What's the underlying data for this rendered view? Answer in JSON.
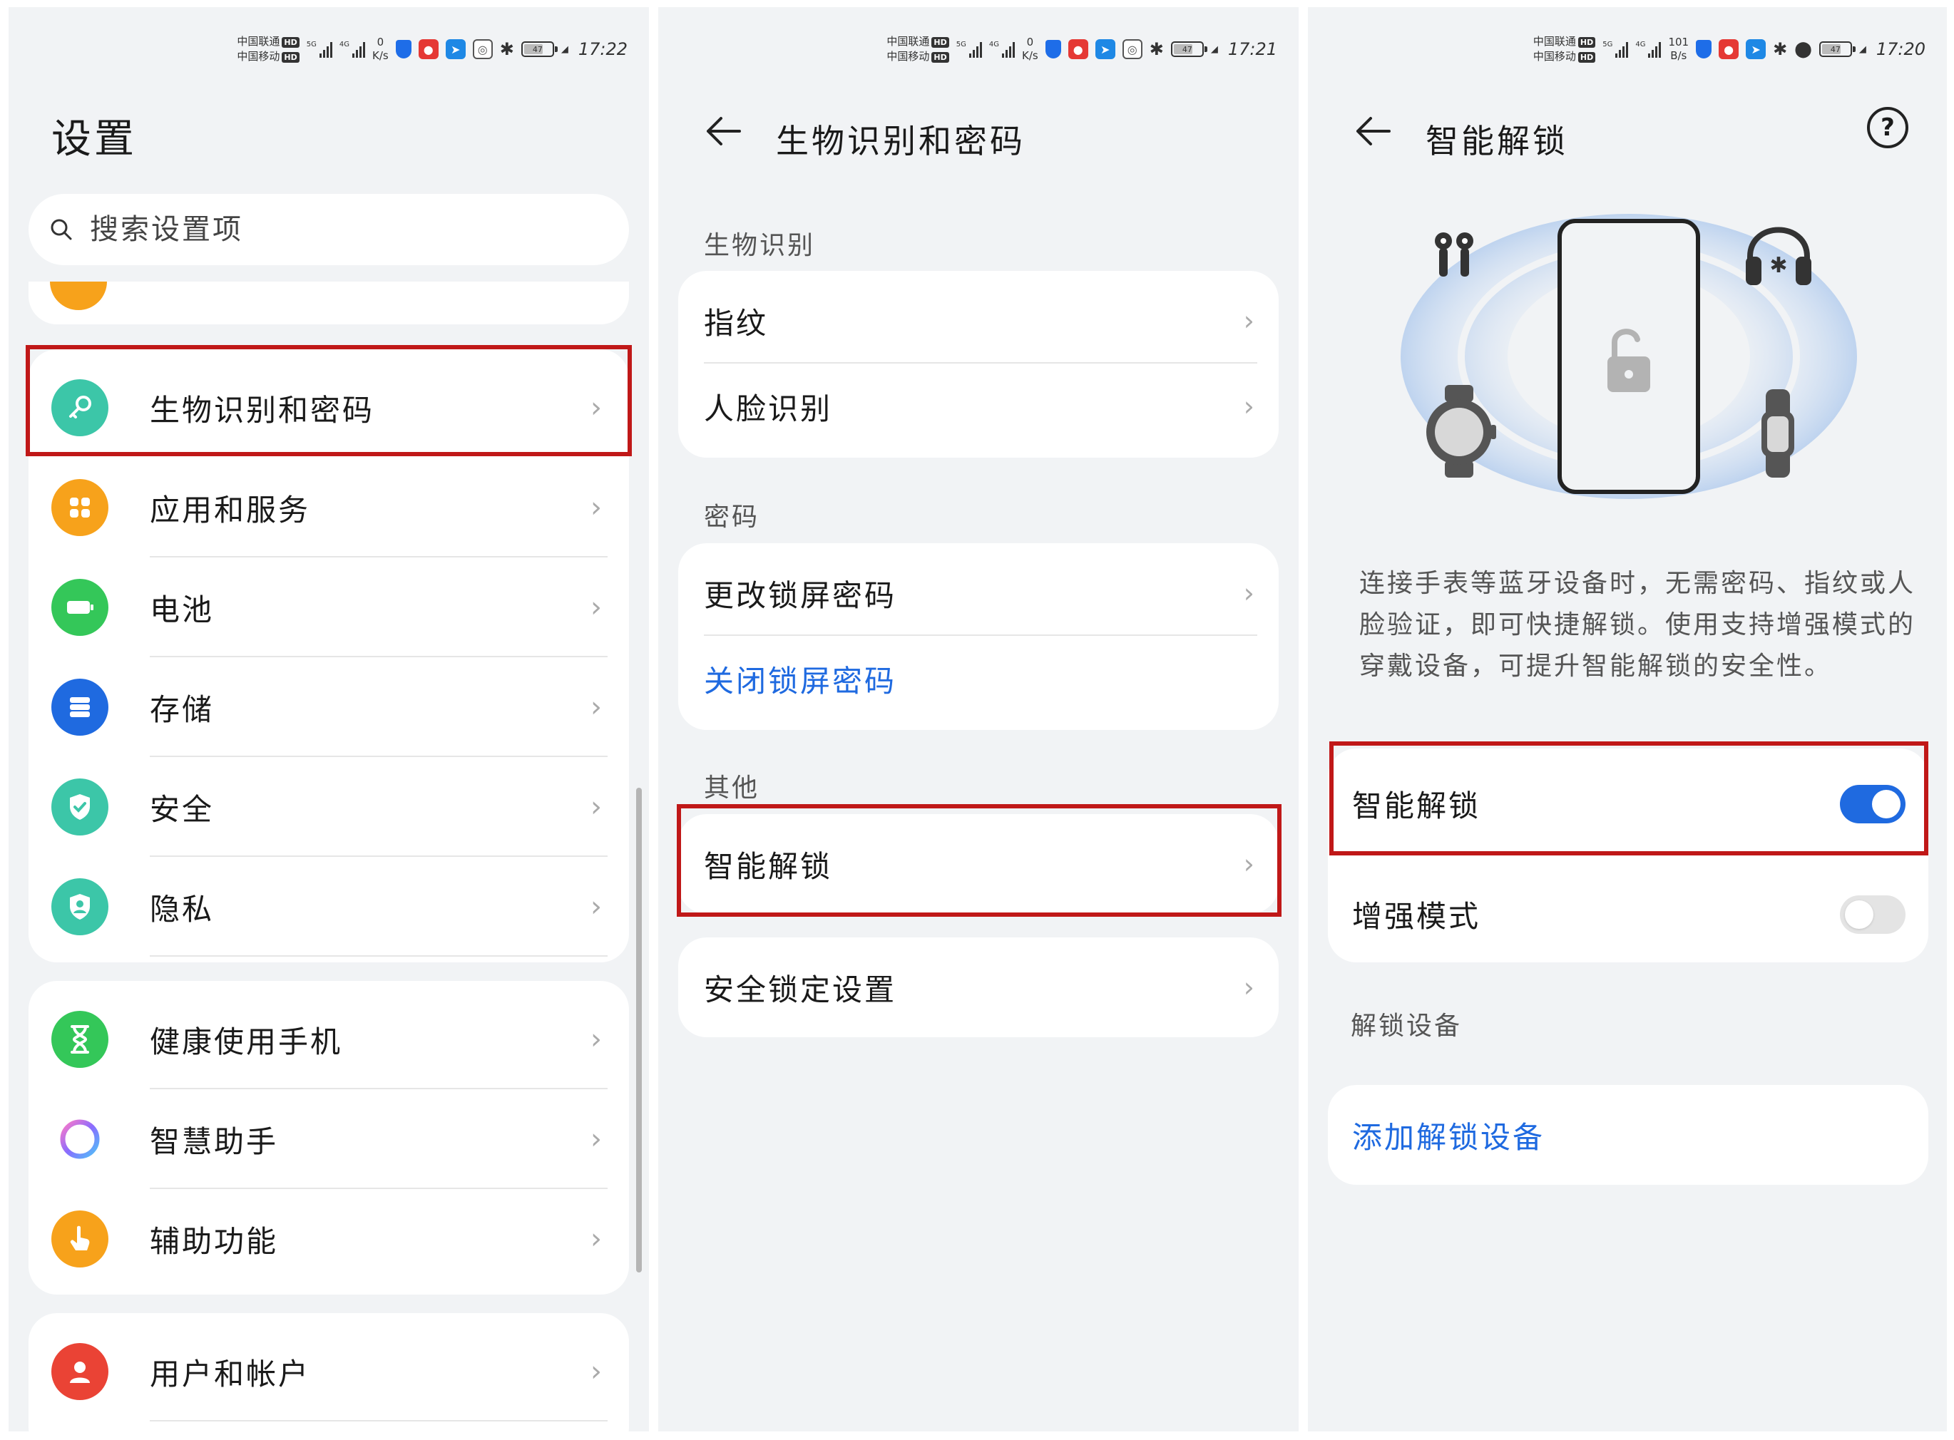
{
  "colors": {
    "accent": "#1f6ae0",
    "highlight_box": "#c01818",
    "panel_bg": "#f1f3f5"
  },
  "status_panels": [
    {
      "carrier1": "中国联通",
      "carrier2": "中国移动",
      "hd": "HD",
      "net1": "5G",
      "net2": "4G",
      "speed_value": "0",
      "speed_unit": "K/s",
      "time": "17:22"
    },
    {
      "carrier1": "中国联通",
      "carrier2": "中国移动",
      "hd": "HD",
      "net1": "5G",
      "net2": "4G",
      "speed_value": "0",
      "speed_unit": "K/s",
      "time": "17:21"
    },
    {
      "carrier1": "中国联通",
      "carrier2": "中国移动",
      "hd": "HD",
      "net1": "5G",
      "net2": "4G",
      "speed_value": "101",
      "speed_unit": "B/s",
      "time": "17:20"
    }
  ],
  "battery_level": "47",
  "settings": {
    "title": "设置",
    "search_placeholder": "搜索设置项",
    "groups": [
      [
        {
          "label": "生物识别和密码",
          "icon": "key-icon",
          "color": "#3cc6a8"
        },
        {
          "label": "应用和服务",
          "icon": "apps-grid-icon",
          "color": "#f7a21b"
        },
        {
          "label": "电池",
          "icon": "battery-icon",
          "color": "#34c759"
        },
        {
          "label": "存储",
          "icon": "storage-icon",
          "color": "#1f6ae0"
        },
        {
          "label": "安全",
          "icon": "shield-check-icon",
          "color": "#3cc6a8"
        },
        {
          "label": "隐私",
          "icon": "privacy-shield-icon",
          "color": "#3cc6a8"
        }
      ],
      [
        {
          "label": "健康使用手机",
          "icon": "hourglass-icon",
          "color": "#34c759"
        },
        {
          "label": "智慧助手",
          "icon": "assistant-ring-icon",
          "color": "#b58cff"
        },
        {
          "label": "辅助功能",
          "icon": "hand-pointer-icon",
          "color": "#f7a21b"
        }
      ],
      [
        {
          "label": "用户和帐户",
          "icon": "user-icon",
          "color": "#ea4335"
        }
      ]
    ]
  },
  "biometrics": {
    "title": "生物识别和密码",
    "section_biometric": "生物识别",
    "fingerprint": "指纹",
    "face": "人脸识别",
    "section_password": "密码",
    "change_password": "更改锁屏密码",
    "disable_password": "关闭锁屏密码",
    "section_other": "其他",
    "smart_unlock": "智能解锁",
    "security_lock": "安全锁定设置"
  },
  "smart_unlock": {
    "title": "智能解锁",
    "description": "连接手表等蓝牙设备时，无需密码、指纹或人脸验证，即可快捷解锁。使用支持增强模式的穿戴设备，可提升智能解锁的安全性。",
    "toggle_label": "智能解锁",
    "toggle_on": true,
    "enhanced_label": "增强模式",
    "enhanced_on": false,
    "section_devices": "解锁设备",
    "add_device": "添加解锁设备"
  }
}
